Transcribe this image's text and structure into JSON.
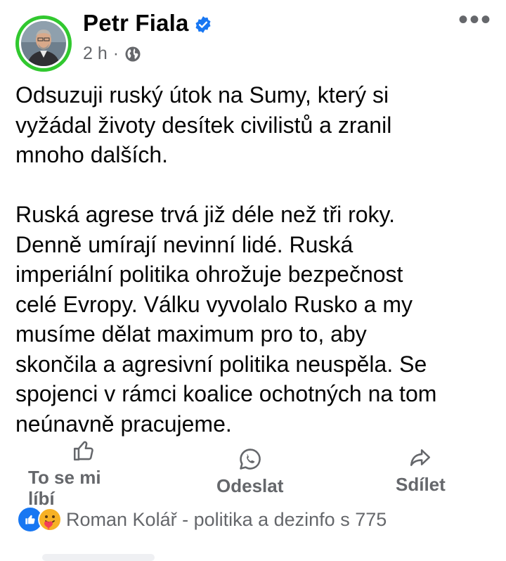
{
  "post": {
    "author": "Petr Fiala",
    "time": "2 h",
    "separator": "·",
    "more": "•••",
    "text": "Odsuzuji ruský útok na Sumy, který si\nvyžádal životy desítek civilistů a zranil\nmnoho dalších.\n\nRuská agrese trvá již déle než tři roky.\nDenně umírají nevinní lidé. Ruská\nimperiální politika ohrožuje bezpečnost\ncelé Evropy. Válku vyvolalo Rusko a my\nmusíme dělat maximum pro to, aby\nskončila a agresivní politika neuspěla. Se\nspojenci v rámci koalice ochotných na tom\nneúnavně pracujeme."
  },
  "actions": {
    "like": "To se mi líbí",
    "send": "Odeslat",
    "share": "Sdílet"
  },
  "reactions": {
    "summary": "Roman Kolář - politika a dezinfo s 775"
  },
  "icons": {
    "verified": "verified-badge-icon",
    "audience": "globe-icon",
    "like": "thumbs-up-icon",
    "send": "whatsapp-icon",
    "share": "share-arrow-icon"
  },
  "colors": {
    "avatar_ring": "#31c82f",
    "verified": "#1877f2",
    "secondary_text": "#65676b"
  }
}
